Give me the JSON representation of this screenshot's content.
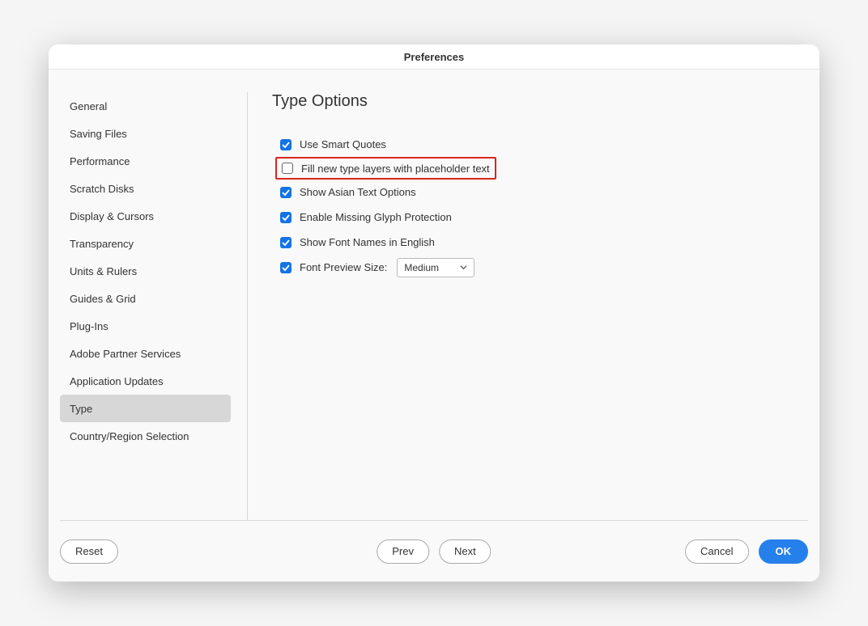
{
  "title": "Preferences",
  "sidebar": {
    "items": [
      {
        "label": "General"
      },
      {
        "label": "Saving Files"
      },
      {
        "label": "Performance"
      },
      {
        "label": "Scratch Disks"
      },
      {
        "label": "Display & Cursors"
      },
      {
        "label": "Transparency"
      },
      {
        "label": "Units & Rulers"
      },
      {
        "label": "Guides & Grid"
      },
      {
        "label": "Plug-Ins"
      },
      {
        "label": "Adobe Partner Services"
      },
      {
        "label": "Application Updates"
      },
      {
        "label": "Type"
      },
      {
        "label": "Country/Region Selection"
      }
    ],
    "selectedIndex": 11
  },
  "content": {
    "title": "Type Options",
    "options": [
      {
        "label": "Use Smart Quotes",
        "checked": true
      },
      {
        "label": "Fill new type layers with placeholder text",
        "checked": false,
        "highlighted": true
      },
      {
        "label": "Show Asian Text Options",
        "checked": true
      },
      {
        "label": "Enable Missing Glyph Protection",
        "checked": true
      },
      {
        "label": "Show Font Names in English",
        "checked": true
      }
    ],
    "fontPreview": {
      "label": "Font Preview Size:",
      "checked": true,
      "value": "Medium"
    }
  },
  "buttons": {
    "reset": "Reset",
    "prev": "Prev",
    "next": "Next",
    "cancel": "Cancel",
    "ok": "OK"
  }
}
